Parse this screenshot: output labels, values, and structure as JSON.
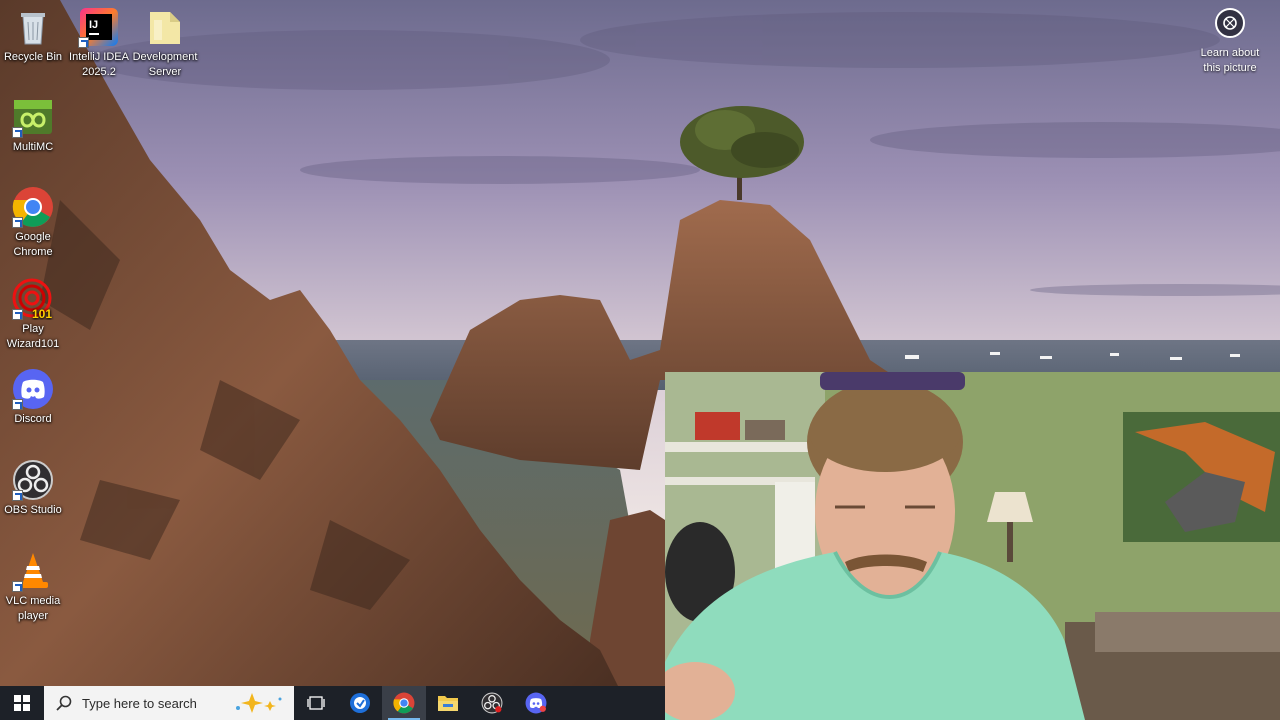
{
  "desktop": {
    "icons": [
      {
        "label": "Recycle Bin",
        "icon": "recycle-bin-icon"
      },
      {
        "label": "IntelliJ IDEA 2025.2",
        "icon": "intellij-icon"
      },
      {
        "label": "Development Server",
        "icon": "folder-icon"
      },
      {
        "label": "MultiMC",
        "icon": "multimc-icon"
      },
      {
        "label": "Google Chrome",
        "icon": "chrome-icon"
      },
      {
        "label": "Play Wizard101",
        "icon": "wizard101-icon"
      },
      {
        "label": "Discord",
        "icon": "discord-icon"
      },
      {
        "label": "OBS Studio",
        "icon": "obs-icon"
      },
      {
        "label": "VLC media player",
        "icon": "vlc-icon"
      }
    ],
    "intellij_glyph": "IJ",
    "wizard_glyph": "101",
    "learn_about_label": "Learn about this picture"
  },
  "taskbar": {
    "search_placeholder": "Type here to search",
    "apps": [
      {
        "name": "task-view",
        "icon": "task-view-icon"
      },
      {
        "name": "app-blue",
        "icon": "blue-app-icon"
      },
      {
        "name": "chrome",
        "icon": "chrome-icon",
        "active": true
      },
      {
        "name": "file-explorer",
        "icon": "folder-icon"
      },
      {
        "name": "obs",
        "icon": "obs-icon"
      },
      {
        "name": "discord",
        "icon": "discord-icon"
      }
    ]
  },
  "colors": {
    "taskbar_bg": "#1d2128",
    "active_indicator": "#76b9ed",
    "chrome_red": "#db4437",
    "chrome_yellow": "#f4b400",
    "chrome_green": "#0f9d58",
    "chrome_blue": "#4285f4",
    "discord_blurple": "#5865f2"
  }
}
